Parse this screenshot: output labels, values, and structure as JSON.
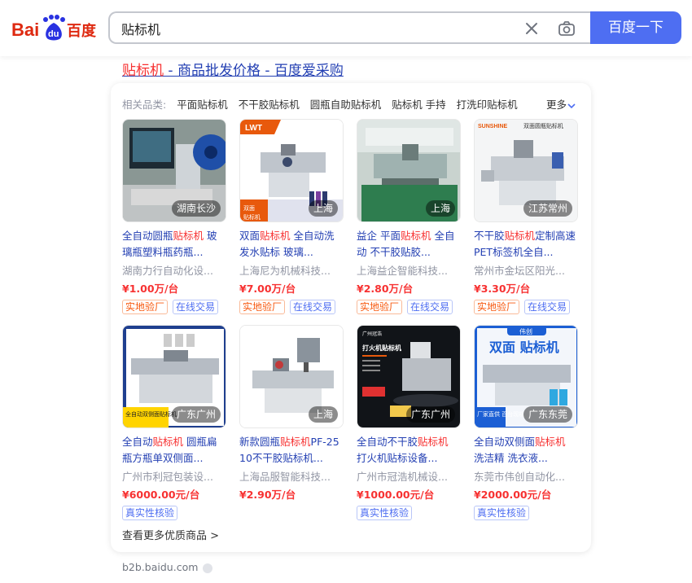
{
  "search": {
    "logo_text_left": "Bai",
    "logo_text_right": "百度",
    "query": "贴标机",
    "button_label": "百度一下",
    "brand_color": "#4e6ef2"
  },
  "result": {
    "title_highlight": "贴标机",
    "title_rest": " - 商品批发价格 - 百度爱采购",
    "related_label": "相关品类:",
    "related_tags": [
      "平面贴标机",
      "不干胶贴标机",
      "圆瓶自助贴标机",
      "贴标机 手持",
      "打洗印贴标机"
    ],
    "more_label": "更多",
    "see_more": "查看更多优质商品 >",
    "source": "b2b.baidu.com"
  },
  "products": [
    {
      "title_a": "全自动圆瓶",
      "title_hl": "贴标机",
      "title_b": " 玻璃瓶塑料瓶药瓶...",
      "company": "湖南力行自动化设...",
      "price": "¥1.00万/台",
      "location": "湖南长沙",
      "badges": [
        "实地验厂",
        "在线交易"
      ]
    },
    {
      "title_a": "双面",
      "title_hl": "贴标机",
      "title_b": " 全自动洗发水贴标 玻璃...",
      "company": "上海尼为机械科技...",
      "price": "¥7.00万/台",
      "location": "上海",
      "badges": [
        "实地验厂",
        "在线交易"
      ]
    },
    {
      "title_a": "益企 平面",
      "title_hl": "贴标机",
      "title_b": " 全自动 不干胶贴胶...",
      "company": "上海益企智能科技...",
      "price": "¥2.80万/台",
      "location": "上海",
      "badges": [
        "实地验厂",
        "在线交易"
      ]
    },
    {
      "title_a": "不干胶",
      "title_hl": "贴标机",
      "title_b": "定制高速PET标签机全自...",
      "company": "常州市金坛区阳光...",
      "price": "¥3.30万/台",
      "location": "江苏常州",
      "badges": [
        "实地验厂",
        "在线交易"
      ]
    },
    {
      "title_a": "全自动",
      "title_hl": "贴标机",
      "title_b": " 圆瓶扁瓶方瓶单双侧面...",
      "company": "广州市利冠包装设...",
      "price": "¥6000.00元/台",
      "location": "广东广州",
      "badges": [
        "真实性核验"
      ]
    },
    {
      "title_a": "新款圆瓶",
      "title_hl": "贴标机",
      "title_b": "PF-2510不干胶贴标机...",
      "company": "上海品服智能科技...",
      "price": "¥2.90万/台",
      "location": "上海",
      "badges": []
    },
    {
      "title_a": "全自动不干胶",
      "title_hl": "贴标机",
      "title_b": " 打火机贴标设备...",
      "company": "广州市冠浩机械设...",
      "price": "¥1000.00元/台",
      "location": "广东广州",
      "badges": [
        "真实性核验"
      ]
    },
    {
      "title_a": "全自动双侧面",
      "title_hl": "贴标机",
      "title_b": " 洗洁精 洗衣液...",
      "company": "东莞市伟创自动化...",
      "price": "¥2000.00元/台",
      "location": "广东东莞",
      "badges": [
        "真实性核验"
      ]
    }
  ],
  "thumb_text": {
    "p2_brand": "LWT",
    "p2_caption": "双面贴标机",
    "p4_brand": "SUNSHINE",
    "p4_caption": "双面圆瓶贴标机",
    "p5_caption": "全自动双侧面贴标机",
    "p7_caption": "打火机贴标机",
    "p7_sub": "广州冠浩",
    "p8_top": "伟创",
    "p8_caption": "双面 贴标机",
    "p8_side": "厂家直供 百台现机"
  }
}
